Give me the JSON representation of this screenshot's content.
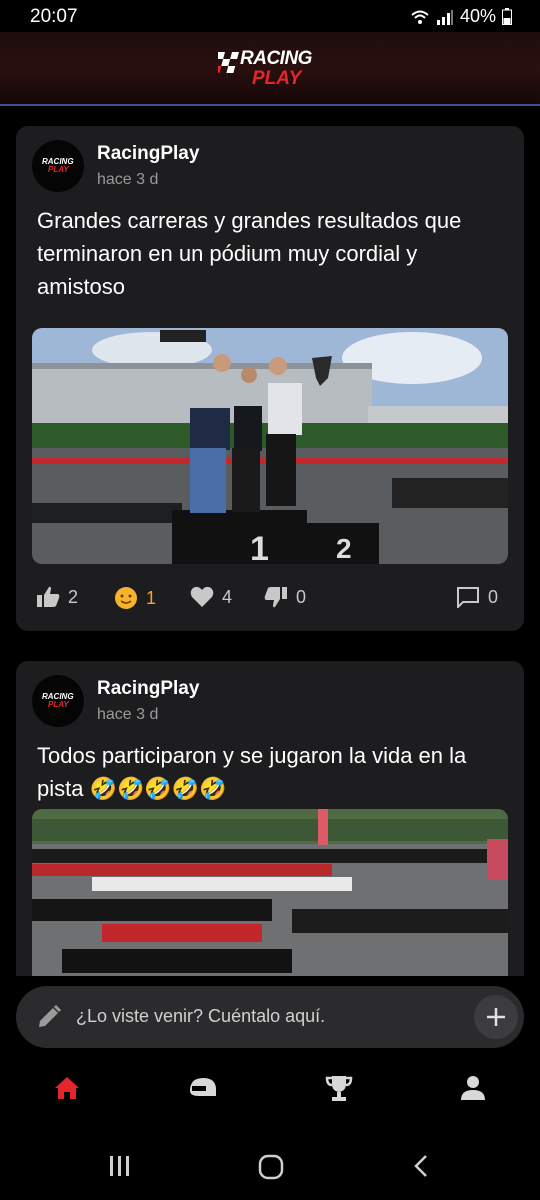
{
  "status": {
    "time": "20:07",
    "battery": "40%"
  },
  "header": {
    "logo_line1": "RACING",
    "logo_line2": "PLAY"
  },
  "posts": [
    {
      "author": "RacingPlay",
      "time": "hace 3 d",
      "avatar_line1": "RACING",
      "avatar_line2": "PLAY",
      "text": "Grandes carreras y grandes resultados que terminaron en un pódium muy cordial y amistoso",
      "reactions": {
        "like": "2",
        "emoji": "1",
        "heart": "4",
        "dislike": "0",
        "comments": "0"
      }
    },
    {
      "author": "RacingPlay",
      "time": "hace 3 d",
      "avatar_line1": "RACING",
      "avatar_line2": "PLAY",
      "text": "Todos participaron y se jugaron la vida en la pista 🤣🤣🤣🤣🤣"
    }
  ],
  "composer": {
    "placeholder": "¿Lo viste venir? Cuéntalo aquí."
  },
  "nav": {
    "items": [
      "home-icon",
      "helmet-icon",
      "trophy-icon",
      "profile-icon"
    ],
    "active": "home-icon",
    "active_color": "#e3262b"
  },
  "podium": {
    "first": "1",
    "second": "2"
  }
}
